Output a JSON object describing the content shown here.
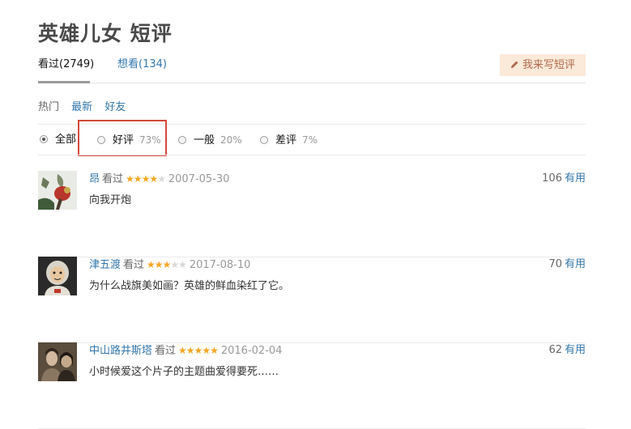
{
  "page": {
    "title": "英雄儿女 短评"
  },
  "tabs": [
    {
      "label": "看过(2749)",
      "active": true
    },
    {
      "label": "想看(134)",
      "active": false
    }
  ],
  "write_button": {
    "label": "我来写短评",
    "icon": "pencil-icon"
  },
  "sort": {
    "hot": "热门",
    "new": "最新",
    "friends": "好友"
  },
  "filters": [
    {
      "label": "全部",
      "percent": "",
      "checked": true
    },
    {
      "label": "好评",
      "percent": "73%",
      "checked": false
    },
    {
      "label": "一般",
      "percent": "20%",
      "checked": false
    },
    {
      "label": "差评",
      "percent": "7%",
      "checked": false
    }
  ],
  "comments": [
    {
      "user": "昂",
      "watched": "看过",
      "stars": 4,
      "date": "2007-05-30",
      "votes": "106",
      "vote_label": "有用",
      "text": "向我开炮"
    },
    {
      "user": "津五渡",
      "watched": "看过",
      "stars": 3,
      "date": "2017-08-10",
      "votes": "70",
      "vote_label": "有用",
      "text": "为什么战旗美如画？英雄的鲜血染红了它。"
    },
    {
      "user": "中山路井斯塔",
      "watched": "看过",
      "stars": 5,
      "date": "2016-02-04",
      "votes": "62",
      "vote_label": "有用",
      "text": "小时候爱这个片子的主题曲爱得要死……"
    }
  ],
  "colors": {
    "link": "#3377aa",
    "star": "#f5a623",
    "highlight": "#d04a3c",
    "button_bg": "#fbe9d9"
  }
}
